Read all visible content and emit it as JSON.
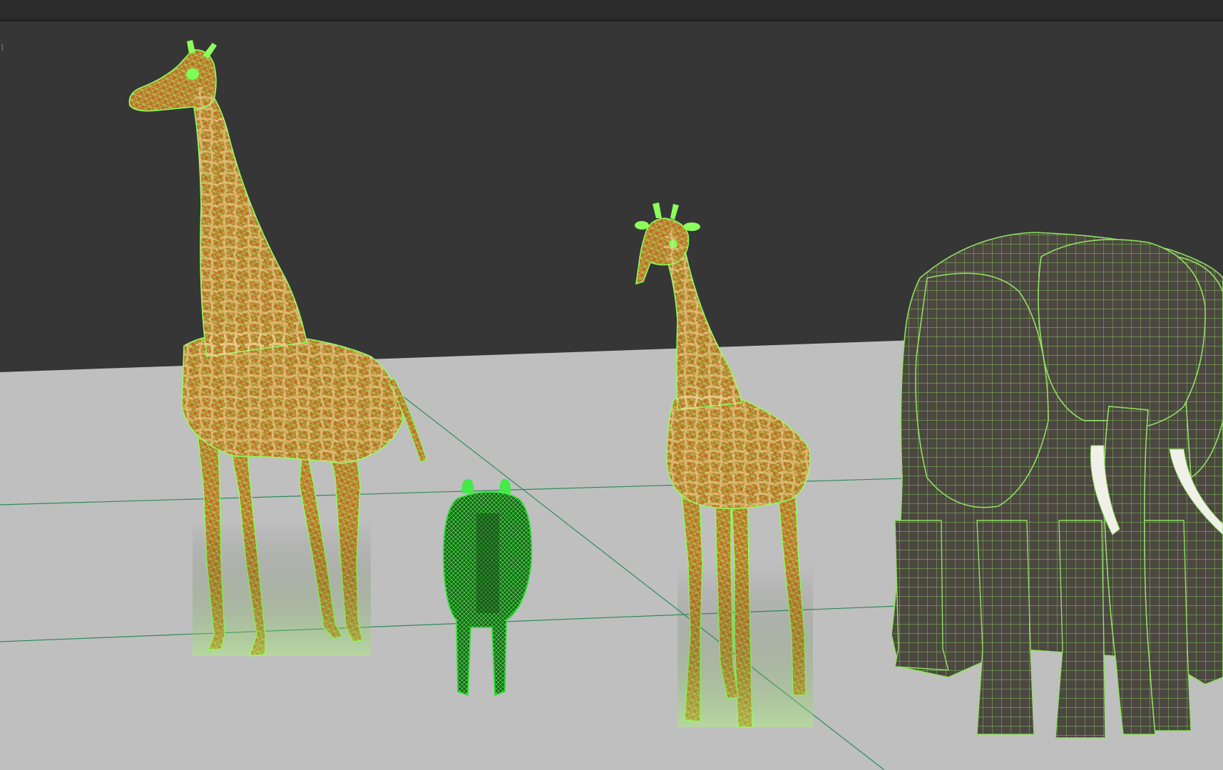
{
  "viewport": {
    "corner_tag": "]"
  },
  "colors": {
    "background": "#363636",
    "topbar": "#2b2b2b",
    "ground": "#bfbfbf",
    "grid_line": "#2f8a5a",
    "wire_bright": "#8cff5a",
    "wire_dark": "#2fcf35",
    "giraffe_fill": "#b8691f",
    "zebra_fill": "#1f6e1f",
    "elephant_fill": "#4e4a44",
    "tusk": "#f0f0e8"
  },
  "scene_objects": [
    {
      "name": "giraffe-large",
      "label": "giraffe"
    },
    {
      "name": "zebra",
      "label": "zebra"
    },
    {
      "name": "giraffe-small",
      "label": "giraffe"
    },
    {
      "name": "elephant",
      "label": "elephant"
    }
  ]
}
